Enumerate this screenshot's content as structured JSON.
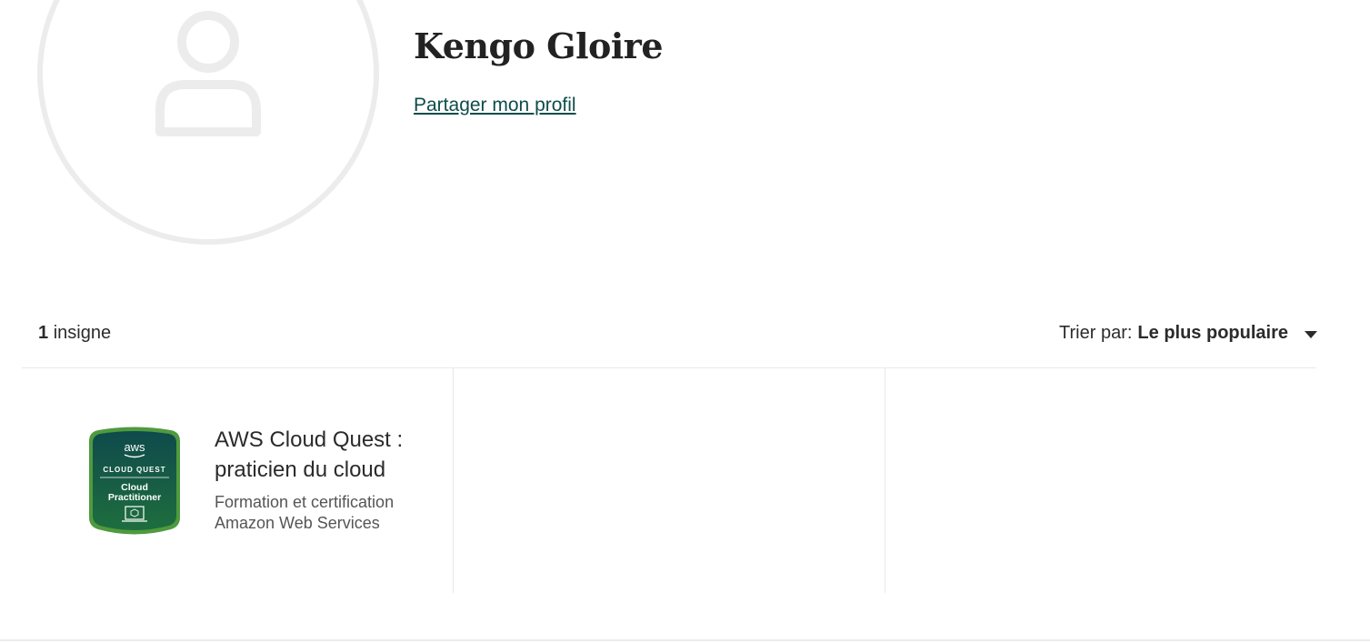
{
  "profile": {
    "name": "Kengo Gloire",
    "share_label": "Partager mon profil"
  },
  "badges_header": {
    "count": "1",
    "count_label": "insigne",
    "sort_prefix": "Trier par:",
    "sort_value": "Le plus populaire"
  },
  "badges": [
    {
      "title": "AWS Cloud Quest : praticien du cloud",
      "issuer": "Formation et certification Amazon Web Services",
      "image": {
        "brand": "aws",
        "line1": "CLOUD QUEST",
        "line2": "Cloud",
        "line3": "Practitioner"
      }
    }
  ],
  "colors": {
    "link": "#0d4d4a",
    "badge_dark": "#0f4a4c",
    "badge_green": "#2a7a3b",
    "avatar_stroke": "#ececec"
  }
}
